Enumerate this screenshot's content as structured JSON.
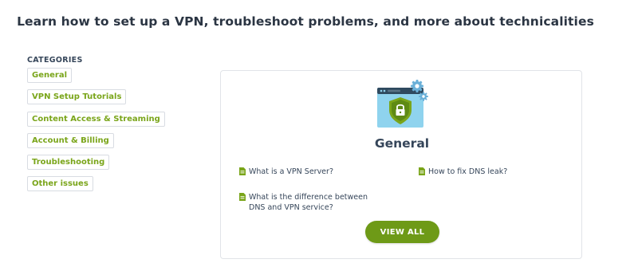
{
  "header": {
    "title": "Learn how to set up a VPN, troubleshoot problems, and more about technicalities"
  },
  "sidebar": {
    "title": "CATEGORIES",
    "items": [
      {
        "label": "General"
      },
      {
        "label": "VPN Setup Tutorials"
      },
      {
        "label": "Content Access & Streaming"
      },
      {
        "label": "Account & Billing"
      },
      {
        "label": "Troubleshooting"
      },
      {
        "label": "Other issues"
      }
    ]
  },
  "card": {
    "icon": "shield-lock-browser-icon",
    "title": "General",
    "articles": [
      {
        "label": "What is a VPN Server?",
        "icon": "document-icon"
      },
      {
        "label": "How to fix DNS leak?",
        "icon": "document-icon"
      },
      {
        "label": "What is the difference between DNS and VPN service?",
        "icon": "document-icon"
      }
    ],
    "button_label": "VIEW ALL"
  },
  "colors": {
    "accent": "#7aa51a",
    "button": "#6e9a17",
    "heading": "#2b3543",
    "border": "#d8dce2",
    "icon_blue": "#8fd3ee",
    "icon_gear": "#6ab0d8"
  }
}
